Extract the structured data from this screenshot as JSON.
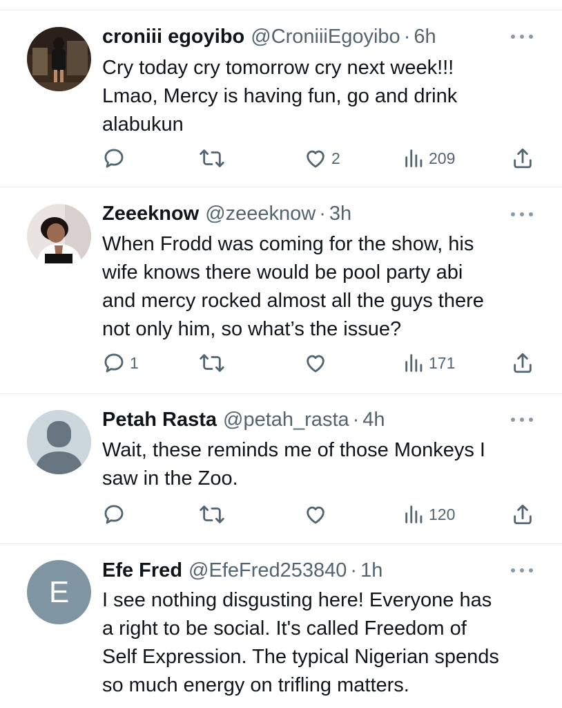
{
  "tweets": [
    {
      "name": "croniii egoyibo",
      "handle": "@CroniiiEgoyibo",
      "separator": "·",
      "time": "6h",
      "lines": [
        "Cry today cry tomorrow cry next week!!!",
        "Lmao, Mercy is having fun, go and drink",
        "alabukun"
      ],
      "replies": "",
      "retweets": "",
      "likes": "2",
      "views": "209",
      "avatar": "photo"
    },
    {
      "name": "Zeeeknow",
      "handle": "@zeeeknow",
      "separator": "·",
      "time": "3h",
      "lines": [
        "When Frodd was coming for the show, his",
        "wife knows there would be pool party abi",
        "and mercy rocked almost all the guys there",
        "not only him, so what’s the issue?"
      ],
      "replies": "1",
      "retweets": "",
      "likes": "",
      "views": "171",
      "avatar": "photo"
    },
    {
      "name": "Petah Rasta",
      "handle": "@petah_rasta",
      "separator": "·",
      "time": "4h",
      "lines": [
        "Wait, these reminds me of those Monkeys I",
        "saw in the Zoo."
      ],
      "replies": "",
      "retweets": "",
      "likes": "",
      "views": "120",
      "avatar": "default"
    },
    {
      "name": "Efe Fred",
      "handle": "@EfeFred253840",
      "separator": "·",
      "time": "1h",
      "lines": [
        "I see nothing disgusting here! Everyone has",
        "a right to be social. It's called Freedom of",
        "Self Expression. The typical Nigerian spends",
        "so much energy on trifling matters."
      ],
      "avatar": "letter",
      "avatar_letter": "E"
    }
  ],
  "icons": {
    "reply": "reply-icon",
    "retweet": "retweet-icon",
    "like": "heart-icon",
    "views": "views-icon",
    "share": "share-icon",
    "more": "more-icon"
  },
  "colors": {
    "text": "#0f1419",
    "secondary": "#536471",
    "divider": "#e6ecf0",
    "letter_avatar_bg": "#7f95a2",
    "default_avatar_bg": "#ccd6dd"
  }
}
